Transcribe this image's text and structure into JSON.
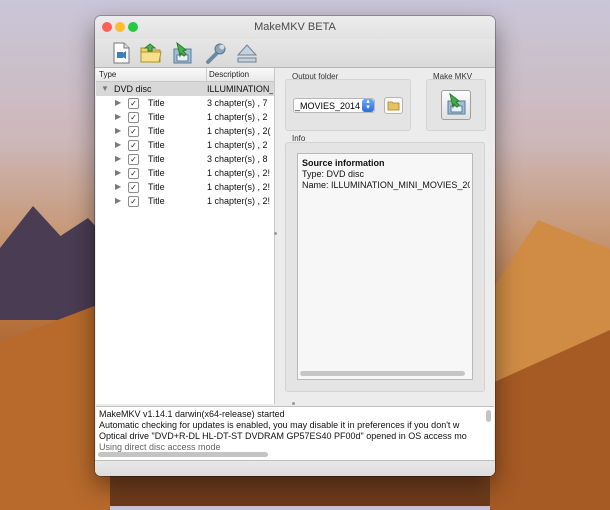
{
  "window": {
    "title": "MakeMKV BETA",
    "traffic_light_colors": [
      "#ff5f57",
      "#febc2e",
      "#28c840"
    ]
  },
  "toolbar": {
    "buttons": [
      "open-video-files",
      "open-disc-folder",
      "backup",
      "preferences",
      "eject"
    ]
  },
  "tree": {
    "columns": [
      "Type",
      "Description"
    ],
    "root": {
      "type": "DVD disc",
      "description": "ILLUMINATION_",
      "checked": true
    },
    "titles": [
      {
        "type": "Title",
        "description": "3 chapter(s) , 7",
        "checked": true
      },
      {
        "type": "Title",
        "description": "1 chapter(s) , 2",
        "checked": true
      },
      {
        "type": "Title",
        "description": "1 chapter(s) , 2(",
        "checked": true
      },
      {
        "type": "Title",
        "description": "1 chapter(s) , 2",
        "checked": true
      },
      {
        "type": "Title",
        "description": "3 chapter(s) , 8",
        "checked": true
      },
      {
        "type": "Title",
        "description": "1 chapter(s) , 2!",
        "checked": true
      },
      {
        "type": "Title",
        "description": "1 chapter(s) , 2!",
        "checked": true
      },
      {
        "type": "Title",
        "description": "1 chapter(s) , 2!",
        "checked": true
      }
    ]
  },
  "output": {
    "label": "Output folder",
    "value": "_MOVIES_2014"
  },
  "make_mkv": {
    "label": "Make MKV"
  },
  "info": {
    "label": "Info",
    "heading": "Source information",
    "lines": [
      "Type: DVD disc",
      "Name: ILLUMINATION_MINI_MOVIES_201"
    ]
  },
  "log": {
    "lines": [
      "MakeMKV v1.14.1 darwin(x64-release) started",
      "Automatic checking for updates is enabled, you may disable it in preferences if you don't w",
      "Optical drive \"DVD+R-DL HL-DT-ST DVDRAM GP57ES40 PF00d\" opened in OS access mo",
      "Using direct disc access mode"
    ]
  }
}
